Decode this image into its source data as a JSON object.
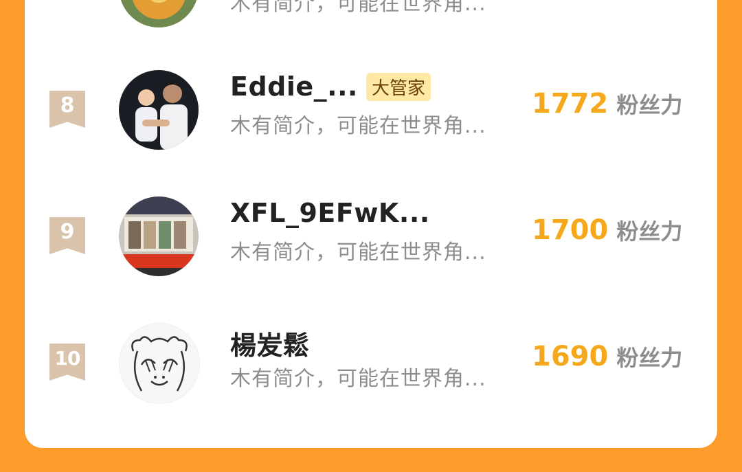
{
  "rows": [
    {
      "rank": "",
      "name": "",
      "badge": "",
      "bio": "木有简介，可能在世界角...",
      "score": "",
      "score_unit": "",
      "avatar": "duck-avatar"
    },
    {
      "rank": "8",
      "name": "Eddie_...",
      "badge": "大管家",
      "bio": "木有简介，可能在世界角...",
      "score": "1772",
      "score_unit": "粉丝力",
      "avatar": "family-photo-avatar"
    },
    {
      "rank": "9",
      "name": "XFL_9EFwK...",
      "badge": "",
      "bio": "木有简介，可能在世界角...",
      "score": "1700",
      "score_unit": "粉丝力",
      "avatar": "bus-photo-avatar"
    },
    {
      "rank": "10",
      "name": "楊𡵢鬆",
      "badge": "",
      "bio": "木有简介，可能在世界角...",
      "score": "1690",
      "score_unit": "粉丝力",
      "avatar": "bear-sketch-avatar"
    }
  ],
  "colors": {
    "background": "#fd9c2b",
    "card": "#ffffff",
    "rank_ribbon": "#d9c3aa",
    "score": "#f5a81c",
    "badge_bg": "#fde9a5",
    "muted_text": "#8d8d8d"
  }
}
